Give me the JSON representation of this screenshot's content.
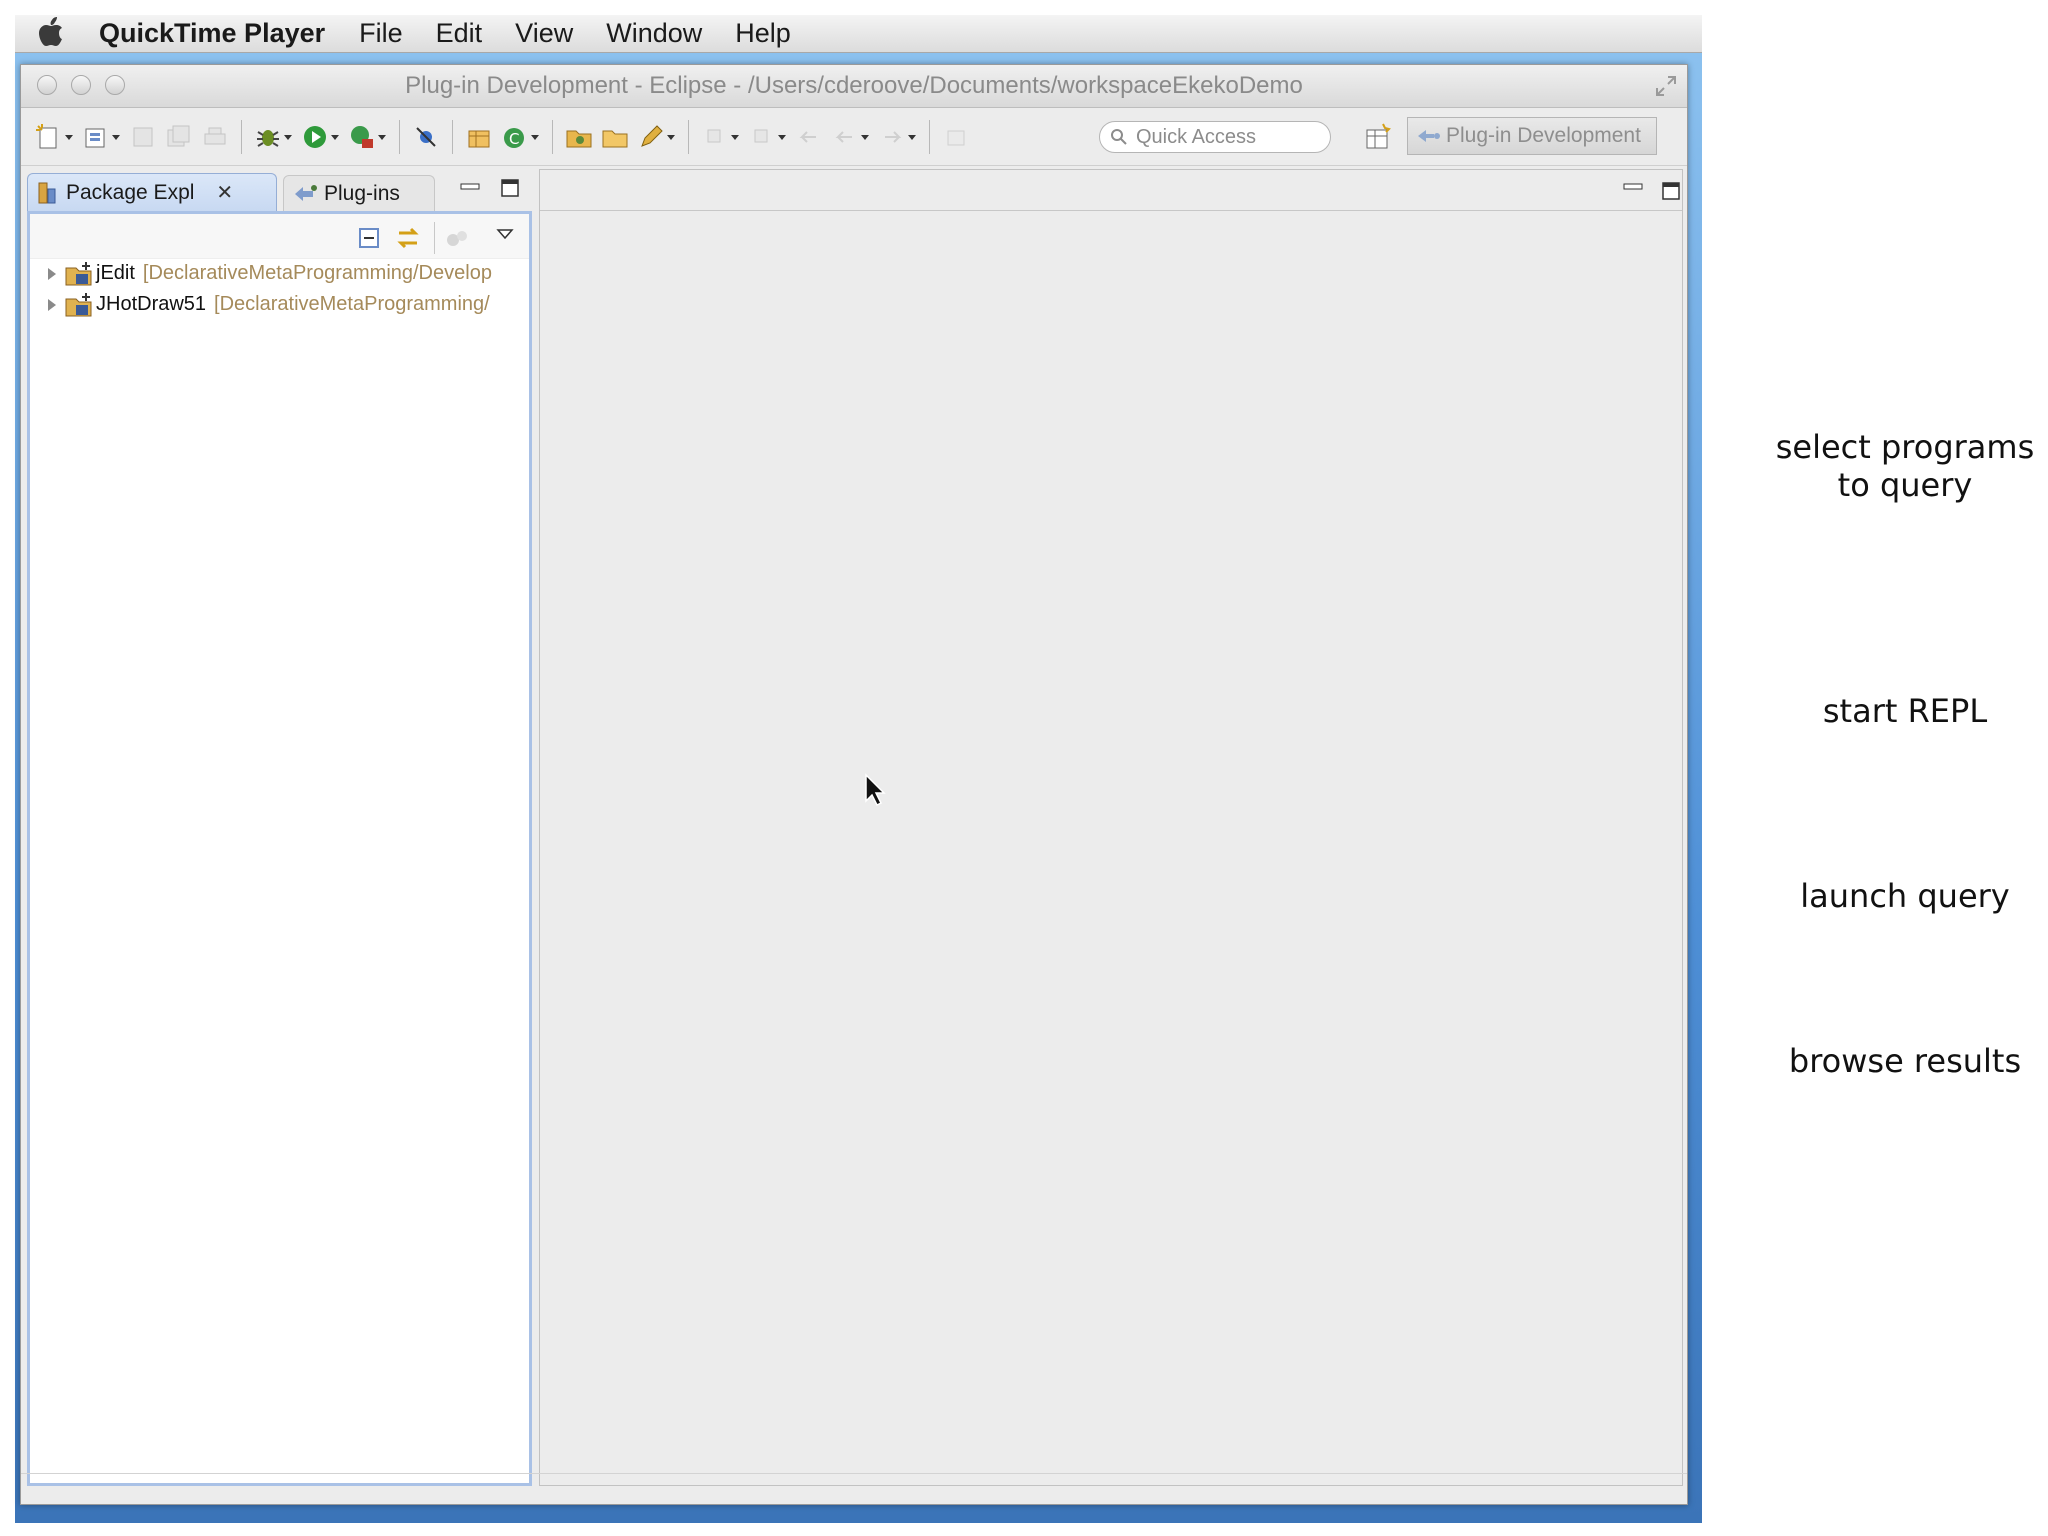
{
  "menubar": {
    "app_name": "QuickTime Player",
    "items": [
      "File",
      "Edit",
      "View",
      "Window",
      "Help"
    ]
  },
  "window": {
    "title": "Plug-in Development - Eclipse - /Users/cderoove/Documents/workspaceEkekoDemo"
  },
  "toolbar": {
    "quick_access_placeholder": "Quick Access",
    "perspective_label": "Plug-in Development"
  },
  "package_explorer": {
    "tab_label": "Package Expl",
    "tab_close": "✕",
    "other_tab_label": "Plug-ins",
    "projects": [
      {
        "name": "jEdit",
        "location": "[DeclarativeMetaProgramming/Develop"
      },
      {
        "name": "JHotDraw51",
        "location": "[DeclarativeMetaProgramming/"
      }
    ]
  },
  "annotations": {
    "step1": "select programs to query",
    "step2": "start REPL",
    "step3": "launch query",
    "step4": "browse results"
  },
  "colors": {
    "active_tab": "#c8d9f2",
    "panel_border": "#a9c1e6",
    "workbench_bg": "#ececec"
  }
}
